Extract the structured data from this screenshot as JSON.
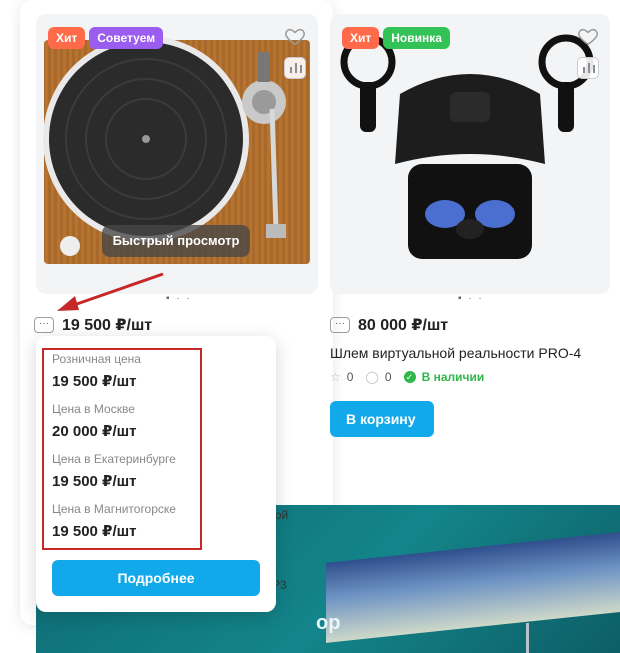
{
  "product1": {
    "badges": [
      "Хит",
      "Советуем"
    ],
    "quick_view": "Быстрый просмотр",
    "price": "19 500 ₽/шт",
    "more_prices_icon": "ellipsis-icon"
  },
  "product2": {
    "badges": [
      "Хит",
      "Новинка"
    ],
    "price": "80 000 ₽/шт",
    "title": "Шлем виртуальной реальности PRO-4",
    "rating": "0",
    "reviews": "0",
    "stock": "В наличии",
    "add_to_cart": "В корзину"
  },
  "price_popup": {
    "items": [
      {
        "label": "Розничная цена",
        "value": "19 500 ₽/шт"
      },
      {
        "label": "Цена в Москве",
        "value": "20 000 ₽/шт"
      },
      {
        "label": "Цена в Екатеринбурге",
        "value": "19 500 ₽/шт"
      },
      {
        "label": "Цена в Магнитогорске",
        "value": "19 500 ₽/шт"
      }
    ],
    "details_button": "Подробнее"
  },
  "bleed_text": {
    "fragment1": "чной",
    "fragment2": "MP3"
  },
  "banner": {
    "text_fragment": "ор"
  },
  "colors": {
    "accent": "#12a9ea",
    "hit": "#ff6b4a",
    "recommend": "#9b5cf0",
    "new": "#33c255",
    "in_stock": "#2fb84a",
    "highlight": "#c62828"
  }
}
